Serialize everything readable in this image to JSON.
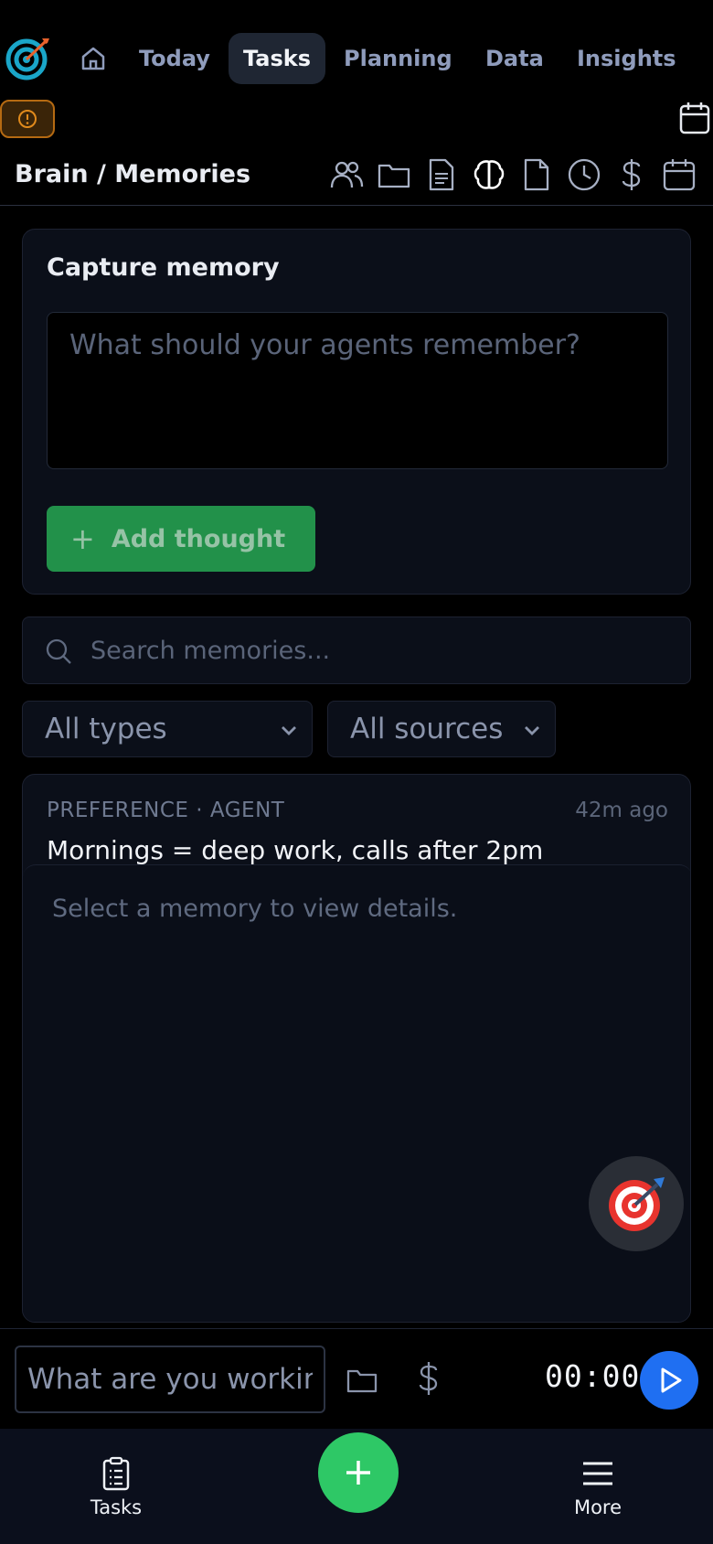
{
  "nav": {
    "tabs": [
      {
        "label": "Today"
      },
      {
        "label": "Tasks"
      },
      {
        "label": "Planning"
      },
      {
        "label": "Data"
      },
      {
        "label": "Insights"
      }
    ],
    "active_tab": "Tasks"
  },
  "brain": {
    "title": "Brain / Memories",
    "icons": [
      "people-icon",
      "folder-icon",
      "document-text-icon",
      "brain-icon",
      "file-icon",
      "clock-icon",
      "dollar-icon",
      "calendar-icon"
    ]
  },
  "capture": {
    "title": "Capture memory",
    "placeholder": "What should your agents remember?",
    "add_label": "Add thought"
  },
  "search": {
    "placeholder": "Search memories..."
  },
  "filters": {
    "type_selected": "All types",
    "source_selected": "All sources"
  },
  "memory": {
    "meta": "PREFERENCE · AGENT",
    "time": "42m ago",
    "text": "Mornings = deep work, calls after 2pm",
    "details_placeholder": "Select a memory to view details."
  },
  "timer": {
    "placeholder": "What are you working on?",
    "value": "00:00"
  },
  "bottom_nav": {
    "tasks_label": "Tasks",
    "more_label": "More"
  },
  "colors": {
    "accent_green": "#22914a",
    "fab_green": "#2ec866",
    "play_blue": "#1f6ff2",
    "alert_orange": "#b56a12"
  }
}
